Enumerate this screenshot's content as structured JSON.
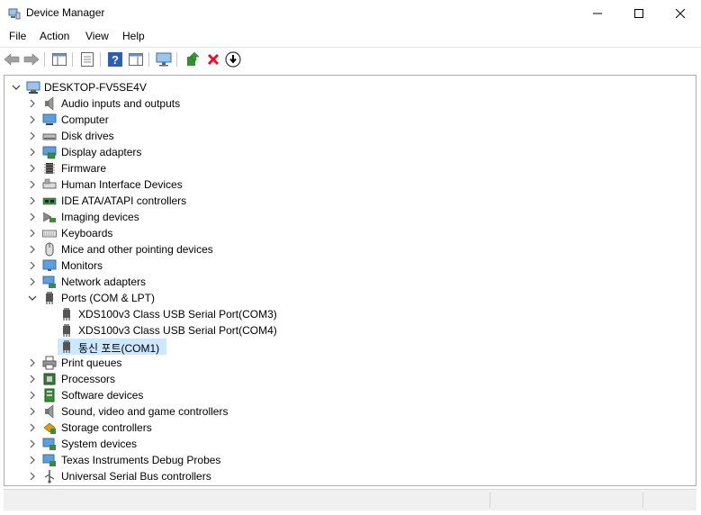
{
  "window": {
    "title": "Device Manager"
  },
  "menu": [
    "File",
    "Action",
    "View",
    "Help"
  ],
  "toolbar": {
    "buttons": [
      "back-arrow-icon",
      "forward-arrow-icon",
      "show-hide-console-tree-icon",
      "properties-icon",
      "help-icon",
      "action-pane-icon",
      "monitor-scan-icon",
      "update-driver-icon",
      "uninstall-icon",
      "disable-device-icon"
    ]
  },
  "tree": {
    "root": "DESKTOP-FV5SE4V",
    "categories": [
      {
        "label": "Audio inputs and outputs",
        "icon": "speaker-icon"
      },
      {
        "label": "Computer",
        "icon": "computer-icon"
      },
      {
        "label": "Disk drives",
        "icon": "disk-drive-icon"
      },
      {
        "label": "Display adapters",
        "icon": "display-adapter-icon"
      },
      {
        "label": "Firmware",
        "icon": "firmware-icon"
      },
      {
        "label": "Human Interface Devices",
        "icon": "hid-icon"
      },
      {
        "label": "IDE ATA/ATAPI controllers",
        "icon": "ide-controller-icon"
      },
      {
        "label": "Imaging devices",
        "icon": "camera-icon"
      },
      {
        "label": "Keyboards",
        "icon": "keyboard-icon"
      },
      {
        "label": "Mice and other pointing devices",
        "icon": "mouse-icon"
      },
      {
        "label": "Monitors",
        "icon": "monitor-icon"
      },
      {
        "label": "Network adapters",
        "icon": "network-adapter-icon"
      },
      {
        "label": "Ports (COM & LPT)",
        "icon": "port-icon",
        "expanded": true,
        "children": [
          {
            "label": "XDS100v3 Class USB Serial Port(COM3)",
            "icon": "port-icon"
          },
          {
            "label": "XDS100v3 Class USB Serial Port(COM4)",
            "icon": "port-icon"
          },
          {
            "label": "통신 포트(COM1)",
            "icon": "port-icon",
            "selected": true
          }
        ]
      },
      {
        "label": "Print queues",
        "icon": "printer-icon"
      },
      {
        "label": "Processors",
        "icon": "processor-icon"
      },
      {
        "label": "Software devices",
        "icon": "software-device-icon"
      },
      {
        "label": "Sound, video and game controllers",
        "icon": "sound-icon"
      },
      {
        "label": "Storage controllers",
        "icon": "storage-controller-icon"
      },
      {
        "label": "System devices",
        "icon": "system-devices-icon"
      },
      {
        "label": "Texas Instruments Debug Probes",
        "icon": "debug-probe-icon"
      },
      {
        "label": "Universal Serial Bus controllers",
        "icon": "usb-icon"
      }
    ]
  },
  "colors": {
    "selection": "#cce8ff",
    "uninstall_red": "#e81123",
    "help_blue": "#2b5fb4"
  }
}
